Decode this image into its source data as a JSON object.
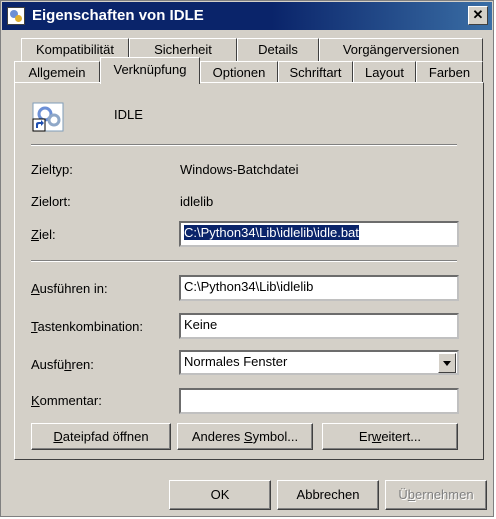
{
  "window": {
    "title": "Eigenschaften von IDLE",
    "close_label": "✕"
  },
  "tabs_row1": [
    {
      "label": "Kompatibilität"
    },
    {
      "label": "Sicherheit"
    },
    {
      "label": "Details"
    },
    {
      "label": "Vorgängerversionen"
    }
  ],
  "tabs_row2": [
    {
      "label": "Allgemein"
    },
    {
      "label": "Verknüpfung",
      "active": true
    },
    {
      "label": "Optionen"
    },
    {
      "label": "Schriftart"
    },
    {
      "label": "Layout"
    },
    {
      "label": "Farben"
    }
  ],
  "shortcut": {
    "name": "IDLE",
    "icon": "shortcut-app-icon"
  },
  "info": {
    "zieltyp_label": "Zieltyp:",
    "zieltyp_value": "Windows-Batchdatei",
    "zielort_label": "Zielort:",
    "zielort_value": "idlelib"
  },
  "fields": {
    "ziel_label_u": "Z",
    "ziel_label_rest": "iel:",
    "ziel_value": "C:\\Python34\\Lib\\idlelib\\idle.bat",
    "ausfuehren_in_label_u": "A",
    "ausfuehren_in_label_rest": "usführen in:",
    "ausfuehren_in_value": "C:\\Python34\\Lib\\idlelib",
    "tasten_label_u": "T",
    "tasten_label_rest": "astenkombination:",
    "tasten_value": "Keine",
    "ausfuehren_label_pre": "Ausfü",
    "ausfuehren_label_u": "h",
    "ausfuehren_label_rest": "ren:",
    "ausfuehren_value": "Normales Fenster",
    "kommentar_label_u": "K",
    "kommentar_label_rest": "ommentar:",
    "kommentar_value": ""
  },
  "buttons": {
    "dateipfad_u": "D",
    "dateipfad_rest": "ateipfad öffnen",
    "symbol_pre": "Anderes ",
    "symbol_u": "S",
    "symbol_rest": "ymbol...",
    "erweitert_pre": "Er",
    "erweitert_u": "w",
    "erweitert_rest": "eitert...",
    "ok": "OK",
    "abbrechen": "Abbrechen",
    "uebernehmen_pre": "Ü",
    "uebernehmen_u": "b",
    "uebernehmen_rest": "ernehmen"
  },
  "colors": {
    "titlebar": "#0a246a",
    "face": "#d4d0c8",
    "selection": "#0a246a"
  }
}
